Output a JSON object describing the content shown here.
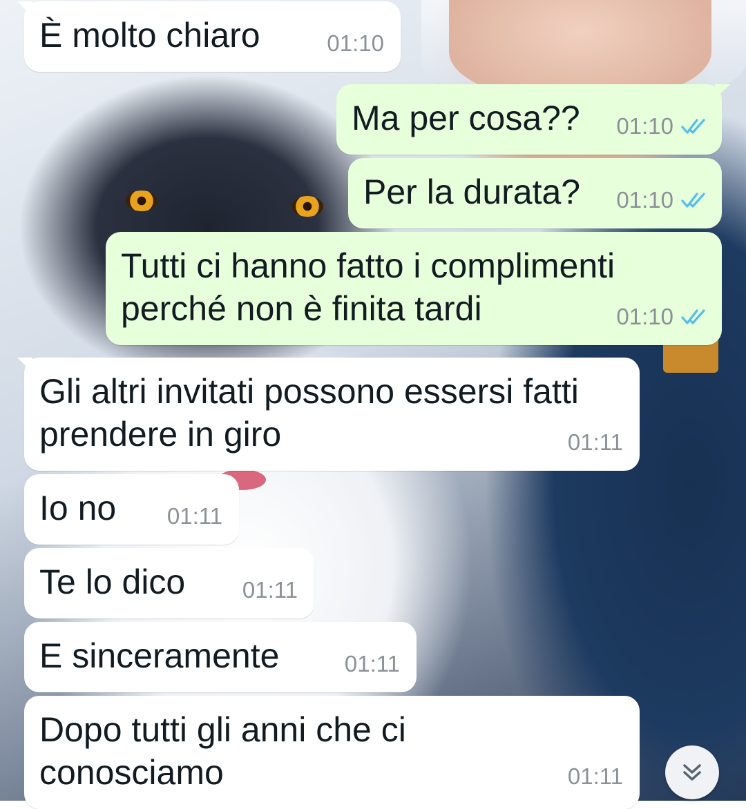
{
  "messages": [
    {
      "direction": "in",
      "text": "È molto chiaro",
      "time": "01:10",
      "first_in_group": true
    },
    {
      "direction": "out",
      "text": "Ma per cosa??",
      "time": "01:10",
      "read": true,
      "first_in_group": true
    },
    {
      "direction": "out",
      "text": "Per la durata?",
      "time": "01:10",
      "read": true,
      "first_in_group": false
    },
    {
      "direction": "out",
      "text": "Tutti ci hanno fatto i complimenti\nperché non è finita tardi",
      "time": "01:10",
      "read": true,
      "first_in_group": false
    },
    {
      "direction": "in",
      "text": "Gli altri invitati possono essersi fatti\nprendere in giro",
      "time": "01:11",
      "first_in_group": true
    },
    {
      "direction": "in",
      "text": "Io no",
      "time": "01:11",
      "first_in_group": false
    },
    {
      "direction": "in",
      "text": "Te lo dico",
      "time": "01:11",
      "first_in_group": false
    },
    {
      "direction": "in",
      "text": "E sinceramente",
      "time": "01:11",
      "first_in_group": false
    },
    {
      "direction": "in",
      "text": "Dopo tutti gli anni che ci\nconosciamo",
      "time": "01:11",
      "first_in_group": false
    }
  ],
  "colors": {
    "incoming_bubble": "#ffffff",
    "outgoing_bubble": "#e7ffdb",
    "read_ticks": "#53bdeb",
    "timestamp": "#8b9196"
  },
  "icons": {
    "read_receipt": "double-check-icon",
    "scroll_down": "double-chevron-down-icon"
  }
}
